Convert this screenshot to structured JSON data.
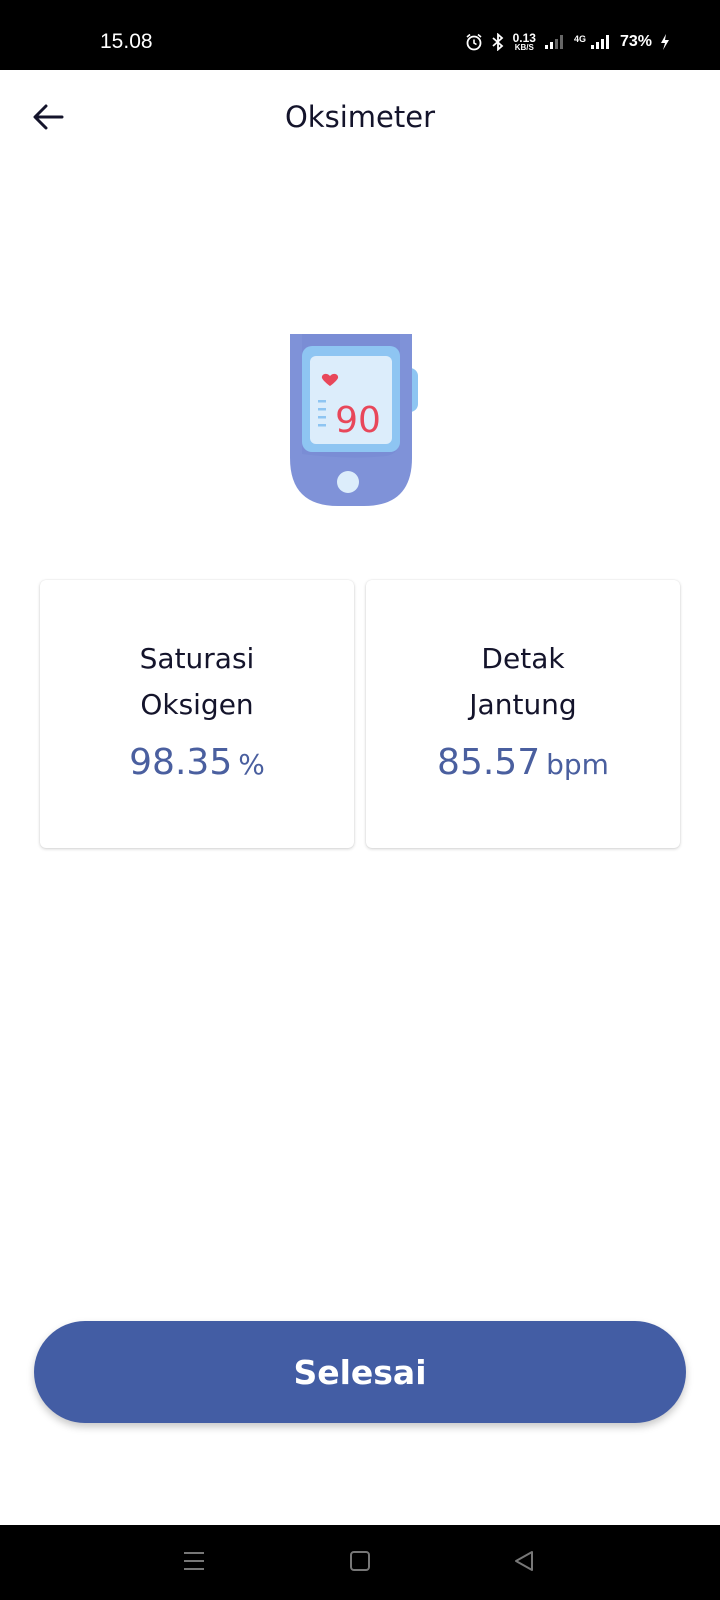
{
  "status_bar": {
    "time": "15.08",
    "net_speed_value": "0.13",
    "net_speed_unit": "KB/S",
    "network_type": "4G",
    "battery": "73%",
    "icons": [
      "alarm-icon",
      "bluetooth-icon",
      "signal-icon",
      "charging-icon"
    ]
  },
  "app_bar": {
    "title": "Oksimeter",
    "back_icon": "arrow-left-icon"
  },
  "device_image": {
    "display_value": "90",
    "icon": "pulse-oximeter-icon"
  },
  "cards": {
    "oxygen": {
      "label_line1": "Saturasi",
      "label_line2": "Oksigen",
      "value": "98.35",
      "unit": "%"
    },
    "heart": {
      "label_line1": "Detak",
      "label_line2": "Jantung",
      "value": "85.57",
      "unit": "bpm"
    }
  },
  "actions": {
    "done_label": "Selesai"
  },
  "colors": {
    "accent": "#435da4",
    "value_text": "#4a5f9f",
    "title_text": "#14142b"
  },
  "nav_bar": {
    "icons": [
      "menu-icon",
      "home-square-icon",
      "back-triangle-icon"
    ]
  }
}
